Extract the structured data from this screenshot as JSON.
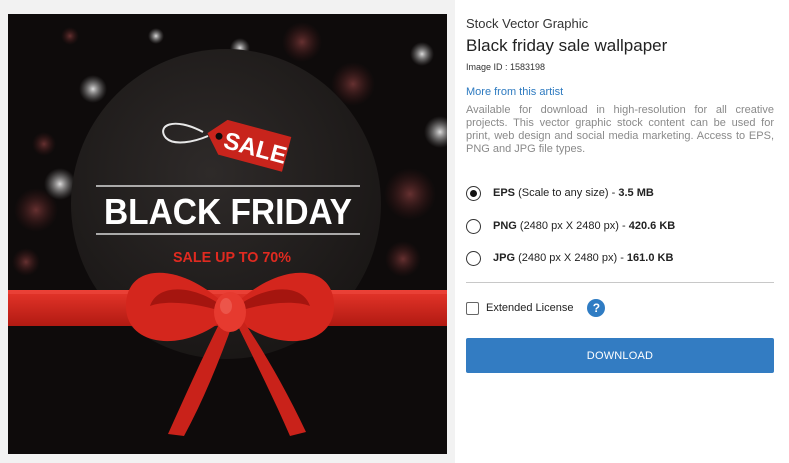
{
  "artwork": {
    "tag_text": "SALE",
    "headline": "BLACK FRIDAY",
    "subline": "SALE UP TO 70%"
  },
  "product": {
    "category": "Stock Vector Graphic",
    "title": "Black friday sale wallpaper",
    "image_id": "Image ID : 1583198",
    "artist_link": "More from this artist",
    "description": "Available for download in high-resolution for all creative projects. This vector graphic stock content can be used for print, web design and social media marketing. Access to EPS, PNG and JPG file types."
  },
  "formats": [
    {
      "name": "EPS",
      "detail": " (Scale to any size) - ",
      "size": "3.5 MB",
      "selected": true
    },
    {
      "name": "PNG",
      "detail": " (2480 px X 2480 px) - ",
      "size": "420.6 KB",
      "selected": false
    },
    {
      "name": "JPG",
      "detail": " (2480 px X 2480 px) - ",
      "size": "161.0 KB",
      "selected": false
    }
  ],
  "license": {
    "label": "Extended License",
    "checked": false,
    "help_icon": "?"
  },
  "download": {
    "label": "DOWNLOAD"
  },
  "colors": {
    "accent": "#337cc2",
    "link": "#2d7ac0",
    "ribbon": "#d9261c",
    "background_dark": "#0e0b0b"
  }
}
